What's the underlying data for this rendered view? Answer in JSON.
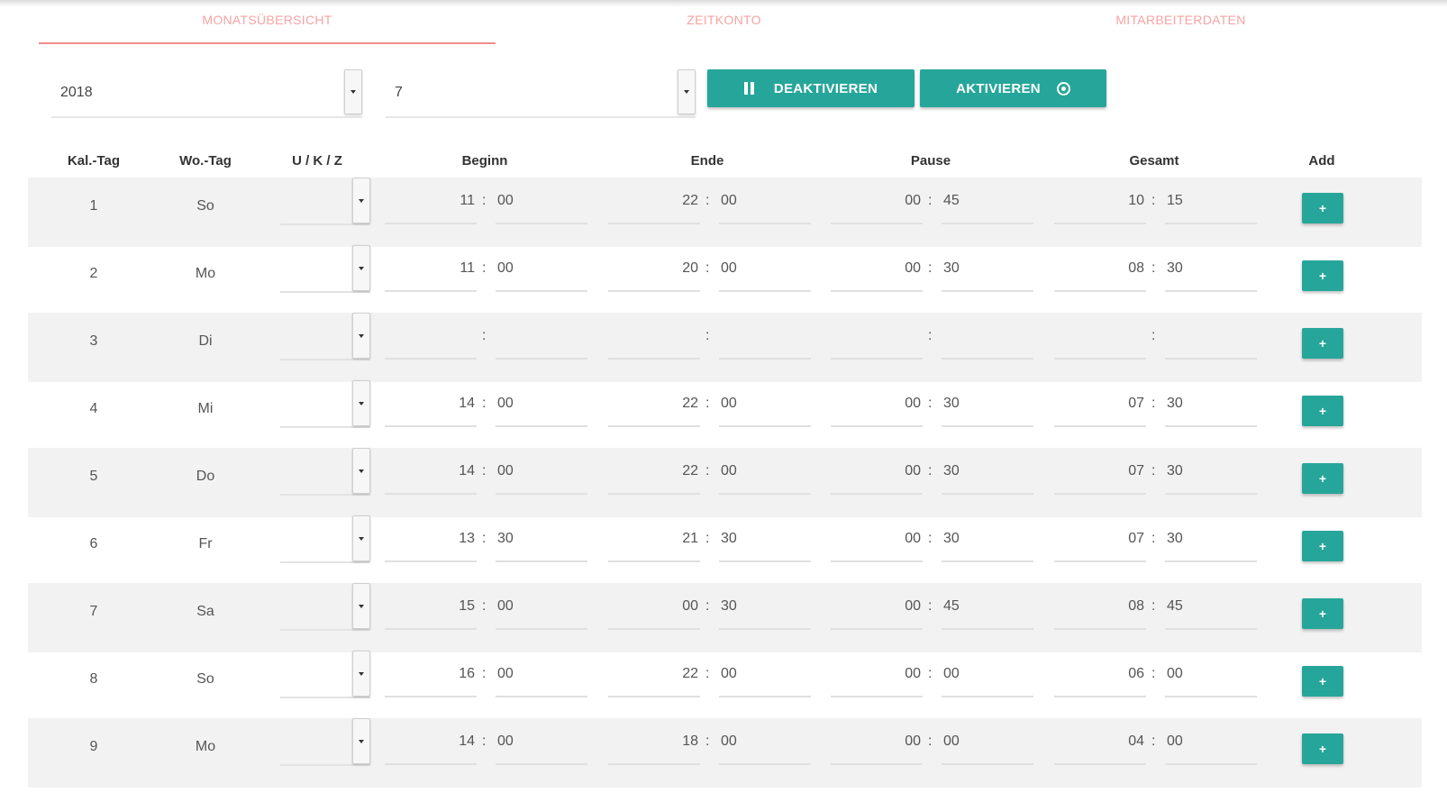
{
  "tabs": [
    {
      "label": "MONATSÜBERSICHT",
      "active": true
    },
    {
      "label": "ZEITKONTO",
      "active": false
    },
    {
      "label": "MITARBEITERDATEN",
      "active": false
    }
  ],
  "filters": {
    "year": "2018",
    "month": "7"
  },
  "buttons": {
    "deactivate": "DEAKTIVIEREN",
    "activate": "AKTIVIEREN"
  },
  "columns": [
    "Kal.-Tag",
    "Wo.-Tag",
    "U / K / Z",
    "Beginn",
    "Ende",
    "Pause",
    "Gesamt",
    "Add"
  ],
  "rows": [
    {
      "day": "1",
      "weekday": "So",
      "begin": [
        "11",
        "00"
      ],
      "end": [
        "22",
        "00"
      ],
      "pause": [
        "00",
        "45"
      ],
      "total": [
        "10",
        "15"
      ]
    },
    {
      "day": "2",
      "weekday": "Mo",
      "begin": [
        "11",
        "00"
      ],
      "end": [
        "20",
        "00"
      ],
      "pause": [
        "00",
        "30"
      ],
      "total": [
        "08",
        "30"
      ]
    },
    {
      "day": "3",
      "weekday": "Di",
      "begin": [
        "",
        ""
      ],
      "end": [
        "",
        ""
      ],
      "pause": [
        "",
        ""
      ],
      "total": [
        "",
        ""
      ]
    },
    {
      "day": "4",
      "weekday": "Mi",
      "begin": [
        "14",
        "00"
      ],
      "end": [
        "22",
        "00"
      ],
      "pause": [
        "00",
        "30"
      ],
      "total": [
        "07",
        "30"
      ]
    },
    {
      "day": "5",
      "weekday": "Do",
      "begin": [
        "14",
        "00"
      ],
      "end": [
        "22",
        "00"
      ],
      "pause": [
        "00",
        "30"
      ],
      "total": [
        "07",
        "30"
      ]
    },
    {
      "day": "6",
      "weekday": "Fr",
      "begin": [
        "13",
        "30"
      ],
      "end": [
        "21",
        "30"
      ],
      "pause": [
        "00",
        "30"
      ],
      "total": [
        "07",
        "30"
      ]
    },
    {
      "day": "7",
      "weekday": "Sa",
      "begin": [
        "15",
        "00"
      ],
      "end": [
        "00",
        "30"
      ],
      "pause": [
        "00",
        "45"
      ],
      "total": [
        "08",
        "45"
      ]
    },
    {
      "day": "8",
      "weekday": "So",
      "begin": [
        "16",
        "00"
      ],
      "end": [
        "22",
        "00"
      ],
      "pause": [
        "00",
        "00"
      ],
      "total": [
        "06",
        "00"
      ]
    },
    {
      "day": "9",
      "weekday": "Mo",
      "begin": [
        "14",
        "00"
      ],
      "end": [
        "18",
        "00"
      ],
      "pause": [
        "00",
        "00"
      ],
      "total": [
        "04",
        "00"
      ]
    }
  ],
  "add_label": "+",
  "colors": {
    "accent": "#26a69a",
    "tab_text": "#f7a3a3",
    "tab_underline": "#f28c8c",
    "row_shade": "#f2f2f2"
  }
}
